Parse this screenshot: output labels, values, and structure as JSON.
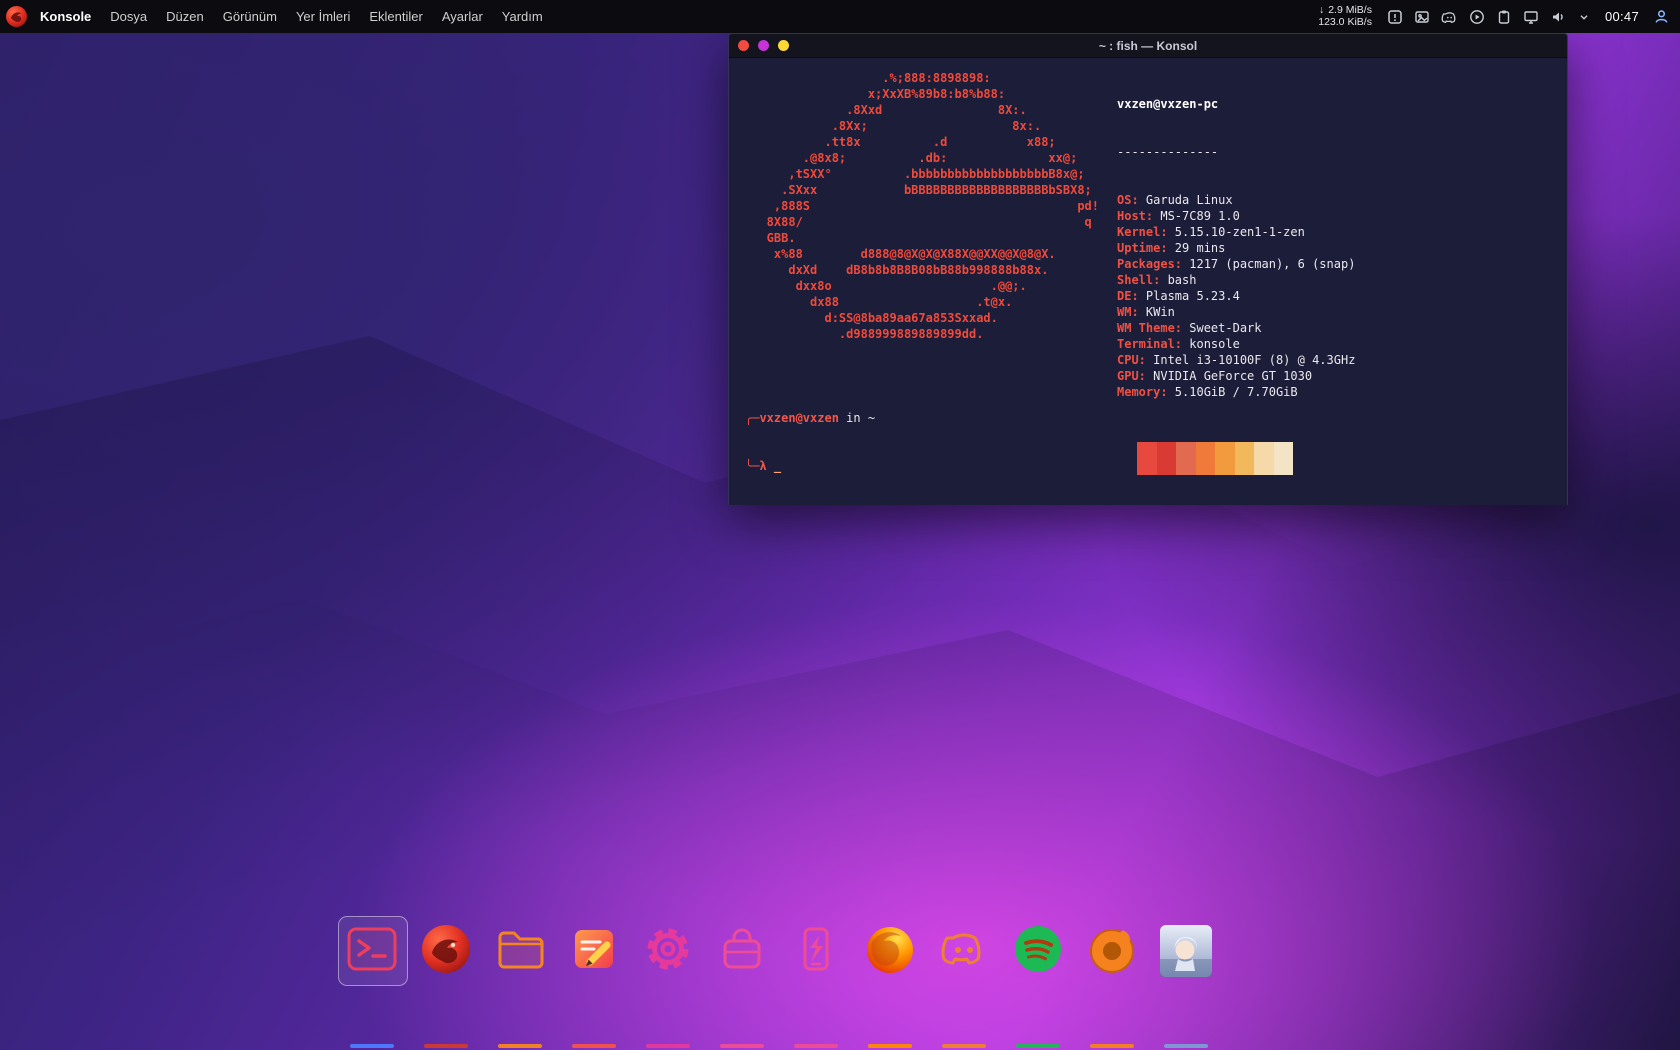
{
  "topbar": {
    "menus": [
      "Konsole",
      "Dosya",
      "Düzen",
      "Görünüm",
      "Yer İmleri",
      "Eklentiler",
      "Ayarlar",
      "Yardım"
    ],
    "net": {
      "down_arrow": "↓",
      "down": "2.9 MiB/s",
      "up": "123.0 KiB/s"
    },
    "clock": "00:47"
  },
  "window": {
    "title": "~ : fish — Konsol"
  },
  "terminal": {
    "ascii_art": [
      "                   .%;888:8898898:",
      "                 x;XxXB%89b8:b8%b88:",
      "              .8Xxd                8X:.",
      "            .8Xx;                    8x:.",
      "           .tt8x          .d           x88;",
      "        .@8x8;          .db:              xx@;",
      "      ,tSXX°          .bbbbbbbbbbbbbbbbbbbB8x@;",
      "     .SXxx            bBBBBBBBBBBBBBBBBBBBbSBX8;",
      "    ,888S                                     pd!",
      "   8X88/                                       q",
      "   GBB.",
      "    x%88        d888@8@X@X@X88X@@XX@@X@8@X.",
      "      dxXd    dB8b8b8B8B08bB88b998888b88x.",
      "       dxx8o                      .@@;.",
      "         dx88                   .t@x.",
      "           d:SS@8ba89aa67a853Sxxad.",
      "             .d988999889889899dd."
    ],
    "neofetch": {
      "title": "vxzen@vxzen-pc",
      "separator": "--------------",
      "entries": [
        {
          "key": "OS",
          "value": "Garuda Linux"
        },
        {
          "key": "Host",
          "value": "MS-7C89 1.0"
        },
        {
          "key": "Kernel",
          "value": "5.15.10-zen1-1-zen"
        },
        {
          "key": "Uptime",
          "value": "29 mins"
        },
        {
          "key": "Packages",
          "value": "1217 (pacman), 6 (snap)"
        },
        {
          "key": "Shell",
          "value": "bash"
        },
        {
          "key": "DE",
          "value": "Plasma 5.23.4"
        },
        {
          "key": "WM",
          "value": "KWin"
        },
        {
          "key": "WM Theme",
          "value": "Sweet-Dark"
        },
        {
          "key": "Terminal",
          "value": "konsole"
        },
        {
          "key": "CPU",
          "value": "Intel i3-10100F (8) @ 4.3GHz"
        },
        {
          "key": "GPU",
          "value": "NVIDIA GeForce GT 1030"
        },
        {
          "key": "Memory",
          "value": "5.10GiB / 7.70GiB"
        }
      ]
    },
    "palette": [
      "#e8493f",
      "#d93a34",
      "#e26a50",
      "#ef7a3a",
      "#f29a3e",
      "#f2b95c",
      "#f6d9a9",
      "#f3e4c6"
    ],
    "prompt": {
      "line1_prefix": "╭─",
      "user": "vxzen@vxzen",
      "rest": " in ~",
      "line2": "╰─λ",
      "cursor": "_"
    }
  },
  "dock": {
    "items": [
      {
        "id": "konsole",
        "accent": "#4d7cff",
        "active": true
      },
      {
        "id": "garuda",
        "accent": "#d03a2e"
      },
      {
        "id": "files",
        "accent": "#f5861f"
      },
      {
        "id": "editor",
        "accent": "#f4534a"
      },
      {
        "id": "settings",
        "accent": "#e5399b"
      },
      {
        "id": "bag",
        "accent": "#ee4d96"
      },
      {
        "id": "kdeconnect",
        "accent": "#ee4d96"
      },
      {
        "id": "firefox",
        "accent": "#ff8a00"
      },
      {
        "id": "discord",
        "accent": "#f08030"
      },
      {
        "id": "spotify",
        "accent": "#1db954"
      },
      {
        "id": "orange-app",
        "accent": "#f5821f"
      },
      {
        "id": "avatar",
        "accent": "#7f9bd6"
      }
    ]
  }
}
